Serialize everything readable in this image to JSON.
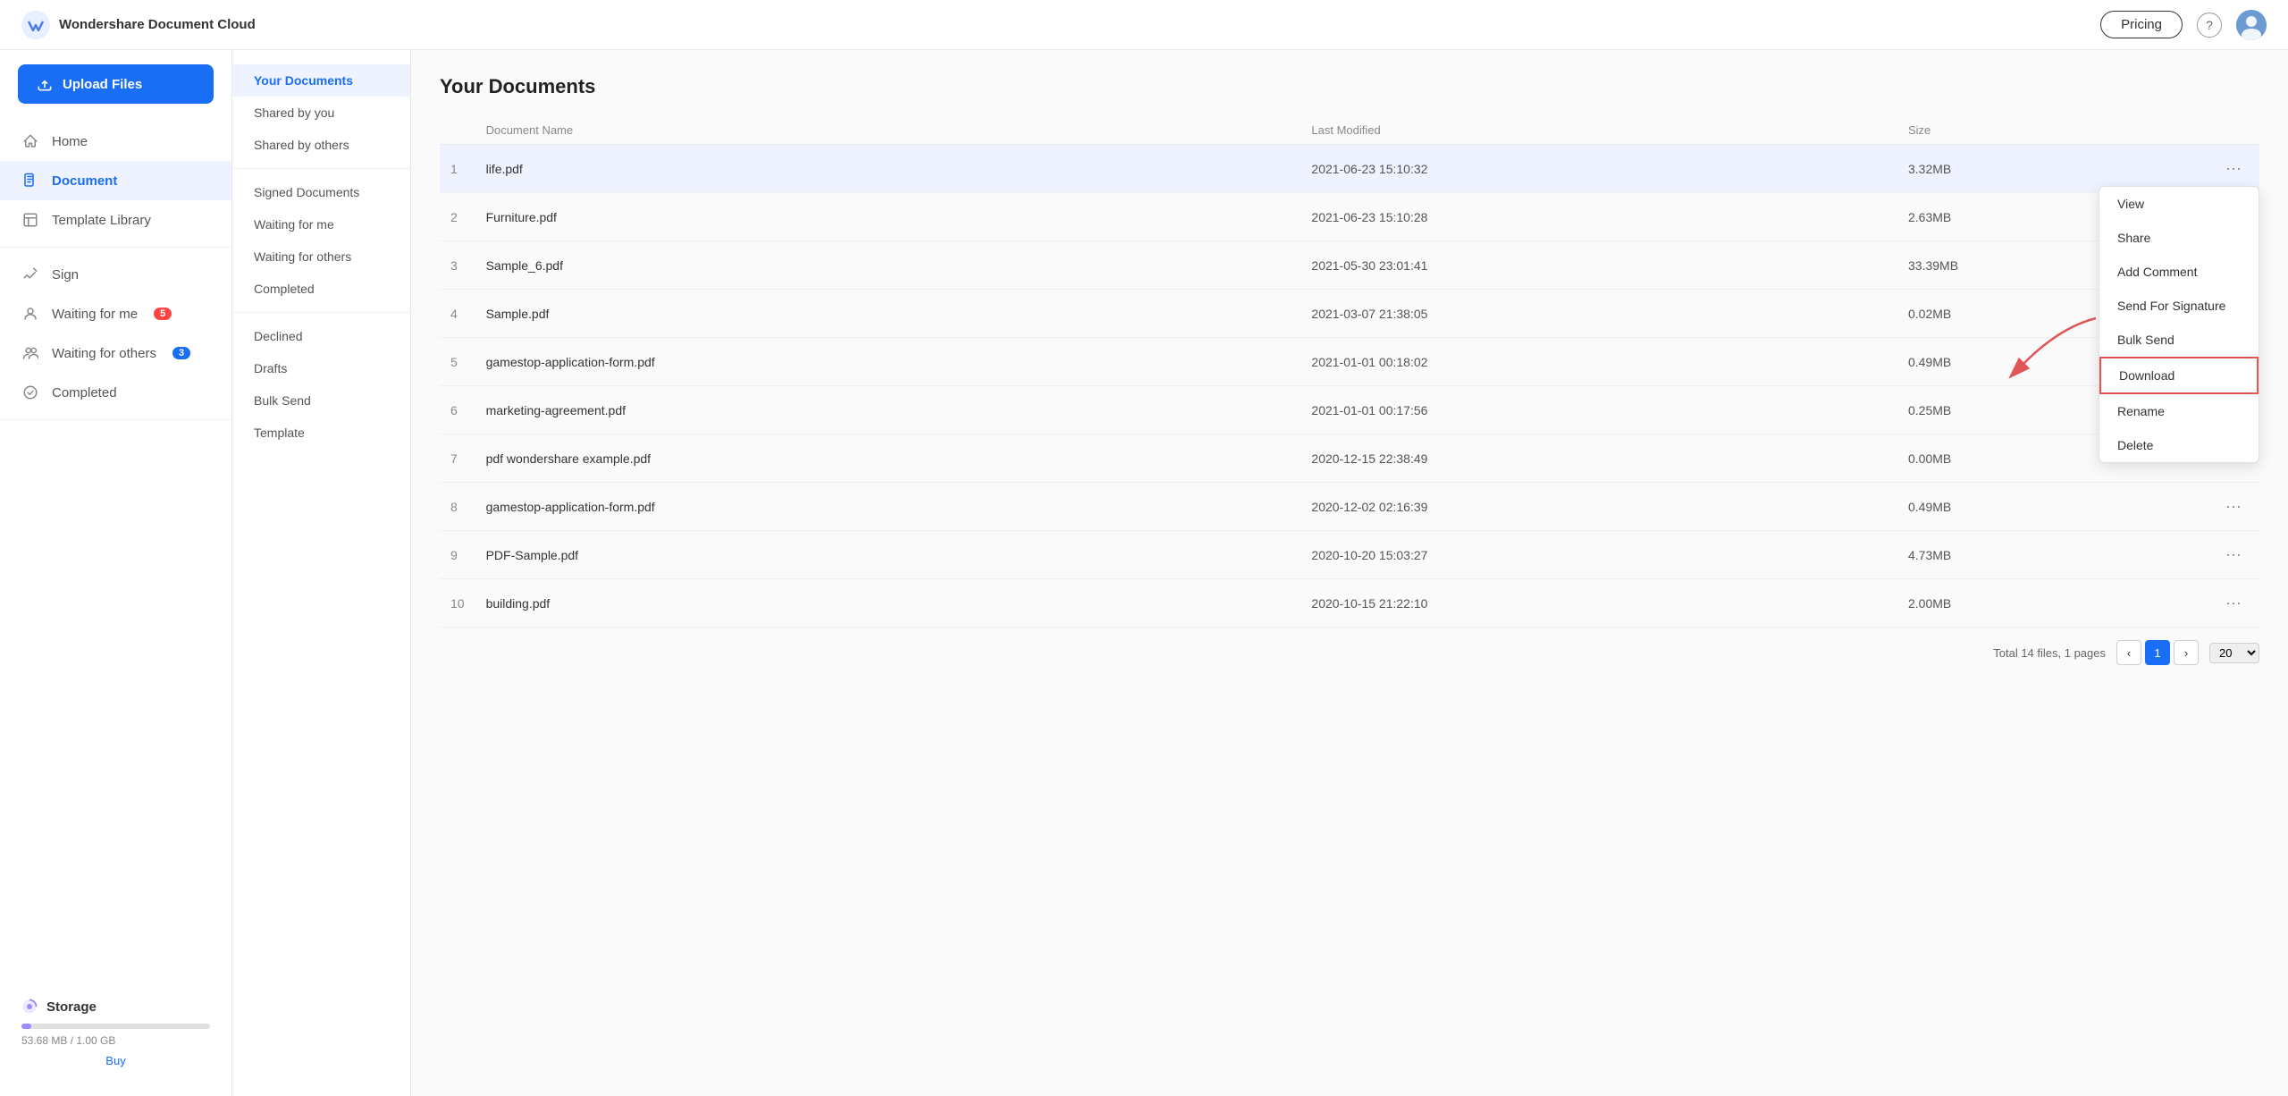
{
  "navbar": {
    "logo_text": "WS",
    "title": "Wondershare Document Cloud",
    "pricing_label": "Pricing",
    "help_icon": "?",
    "avatar_text": "U"
  },
  "sidebar": {
    "upload_label": "Upload Files",
    "nav_items": [
      {
        "id": "home",
        "label": "Home",
        "icon": "home-icon",
        "active": false,
        "badge": null
      },
      {
        "id": "document",
        "label": "Document",
        "icon": "document-icon",
        "active": true,
        "badge": null
      },
      {
        "id": "template-library",
        "label": "Template Library",
        "icon": "template-icon",
        "active": false,
        "badge": null
      },
      {
        "id": "sign",
        "label": "Sign",
        "icon": "sign-icon",
        "active": false,
        "badge": null
      },
      {
        "id": "waiting-for-me",
        "label": "Waiting for me",
        "icon": "waiting-me-icon",
        "active": false,
        "badge": "5",
        "badge_type": "red"
      },
      {
        "id": "waiting-for-others",
        "label": "Waiting for others",
        "icon": "waiting-others-icon",
        "active": false,
        "badge": "3",
        "badge_type": "blue"
      },
      {
        "id": "completed",
        "label": "Completed",
        "icon": "completed-icon",
        "active": false,
        "badge": null
      }
    ],
    "storage": {
      "label": "Storage",
      "used": "53.68 MB",
      "total": "1.00 GB",
      "used_label": "53.68 MB / 1.00 GB",
      "fill_percent": 5.4,
      "buy_label": "Buy"
    }
  },
  "sub_sidebar": {
    "items": [
      {
        "id": "your-documents",
        "label": "Your Documents",
        "active": true
      },
      {
        "id": "shared-by-you",
        "label": "Shared by you",
        "active": false
      },
      {
        "id": "shared-by-others",
        "label": "Shared by others",
        "active": false
      }
    ],
    "signed_section": [
      {
        "id": "signed-documents",
        "label": "Signed Documents",
        "active": false
      },
      {
        "id": "waiting-for-me",
        "label": "Waiting for me",
        "active": false
      },
      {
        "id": "waiting-for-others",
        "label": "Waiting for others",
        "active": false
      },
      {
        "id": "completed",
        "label": "Completed",
        "active": false
      }
    ],
    "other_section": [
      {
        "id": "declined",
        "label": "Declined",
        "active": false
      },
      {
        "id": "drafts",
        "label": "Drafts",
        "active": false
      },
      {
        "id": "bulk-send",
        "label": "Bulk Send",
        "active": false
      },
      {
        "id": "template",
        "label": "Template",
        "active": false
      }
    ]
  },
  "doc_area": {
    "title": "Your Documents",
    "columns": {
      "name": "Document Name",
      "modified": "Last Modified",
      "size": "Size"
    },
    "documents": [
      {
        "num": 1,
        "name": "life.pdf",
        "modified": "2021-06-23 15:10:32",
        "size": "3.32MB",
        "highlight": true
      },
      {
        "num": 2,
        "name": "Furniture.pdf",
        "modified": "2021-06-23 15:10:28",
        "size": "2.63MB",
        "highlight": false
      },
      {
        "num": 3,
        "name": "Sample_6.pdf",
        "modified": "2021-05-30 23:01:41",
        "size": "33.39MB",
        "highlight": false
      },
      {
        "num": 4,
        "name": "Sample.pdf",
        "modified": "2021-03-07 21:38:05",
        "size": "0.02MB",
        "highlight": false
      },
      {
        "num": 5,
        "name": "gamestop-application-form.pdf",
        "modified": "2021-01-01 00:18:02",
        "size": "0.49MB",
        "highlight": false
      },
      {
        "num": 6,
        "name": "marketing-agreement.pdf",
        "modified": "2021-01-01 00:17:56",
        "size": "0.25MB",
        "highlight": false
      },
      {
        "num": 7,
        "name": "pdf wondershare example.pdf",
        "modified": "2020-12-15 22:38:49",
        "size": "0.00MB",
        "highlight": false
      },
      {
        "num": 8,
        "name": "gamestop-application-form.pdf",
        "modified": "2020-12-02 02:16:39",
        "size": "0.49MB",
        "highlight": false
      },
      {
        "num": 9,
        "name": "PDF-Sample.pdf",
        "modified": "2020-10-20 15:03:27",
        "size": "4.73MB",
        "highlight": false
      },
      {
        "num": 10,
        "name": "building.pdf",
        "modified": "2020-10-15 21:22:10",
        "size": "2.00MB",
        "highlight": false
      }
    ],
    "footer": {
      "total_text": "Total 14 files, 1 pages",
      "current_page": 1,
      "per_page": 20
    }
  },
  "context_menu": {
    "items": [
      {
        "id": "view",
        "label": "View"
      },
      {
        "id": "share",
        "label": "Share"
      },
      {
        "id": "add-comment",
        "label": "Add Comment"
      },
      {
        "id": "send-for-signature",
        "label": "Send For Signature"
      },
      {
        "id": "bulk-send",
        "label": "Bulk Send"
      },
      {
        "id": "download",
        "label": "Download",
        "highlight": true
      },
      {
        "id": "rename",
        "label": "Rename"
      },
      {
        "id": "delete",
        "label": "Delete"
      }
    ]
  }
}
